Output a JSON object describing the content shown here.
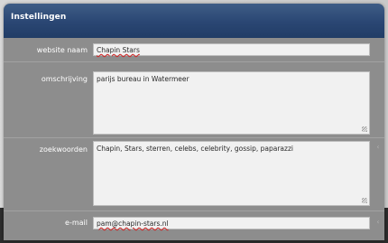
{
  "panel": {
    "title": "Instellingen"
  },
  "fields": {
    "website_name": {
      "label": "website naam",
      "value": "Chapin Stars"
    },
    "description": {
      "label": "omschrijving",
      "value": "parijs bureau in Watermeer"
    },
    "keywords": {
      "label": "zoekwoorden",
      "value": "Chapin, Stars, sterren, celebs, celebrity, gossip, paparazzi"
    },
    "email": {
      "label": "e-mail",
      "value": "pam@chapin-stars.nl"
    }
  },
  "colors": {
    "title_bar": "#2a4673",
    "panel_bg": "#8d8d8d",
    "field_bg": "#f1f1f1",
    "spellcheck": "#d32020"
  }
}
